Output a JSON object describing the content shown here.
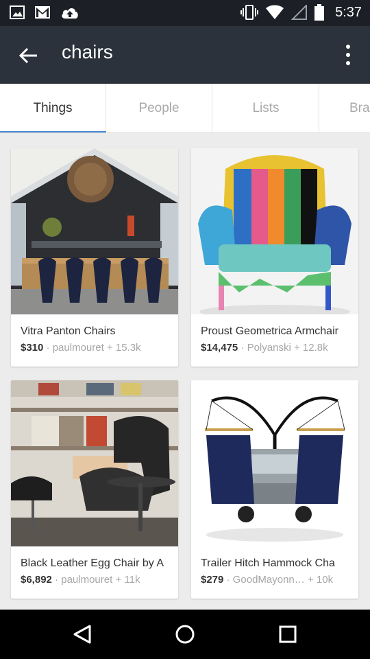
{
  "statusbar": {
    "time": "5:37"
  },
  "appbar": {
    "title": "chairs"
  },
  "tabs": [
    {
      "label": "Things",
      "active": true
    },
    {
      "label": "People",
      "active": false
    },
    {
      "label": "Lists",
      "active": false
    },
    {
      "label": "Bra",
      "active": false
    }
  ],
  "products": [
    {
      "name": "Vitra Panton Chairs",
      "price": "$310",
      "sep": "·",
      "user": "paulmouret",
      "saves": "+ 15.3k"
    },
    {
      "name": "Proust Geometrica Armchair",
      "price": "$14,475",
      "sep": "·",
      "user": "Polyanski",
      "saves": "+ 12.8k"
    },
    {
      "name": "Black Leather Egg Chair by A",
      "price": "$6,892",
      "sep": "·",
      "user": "paulmouret",
      "saves": "+ 11k"
    },
    {
      "name": "Trailer Hitch Hammock Cha",
      "price": "$279",
      "sep": "·",
      "user": "GoodMayonn…",
      "saves": "+ 10k"
    }
  ],
  "colors": {
    "statusbar": "#1c2026",
    "appbar": "#2c323c",
    "tab_indicator": "#4a8ad0",
    "background": "#ececec"
  }
}
